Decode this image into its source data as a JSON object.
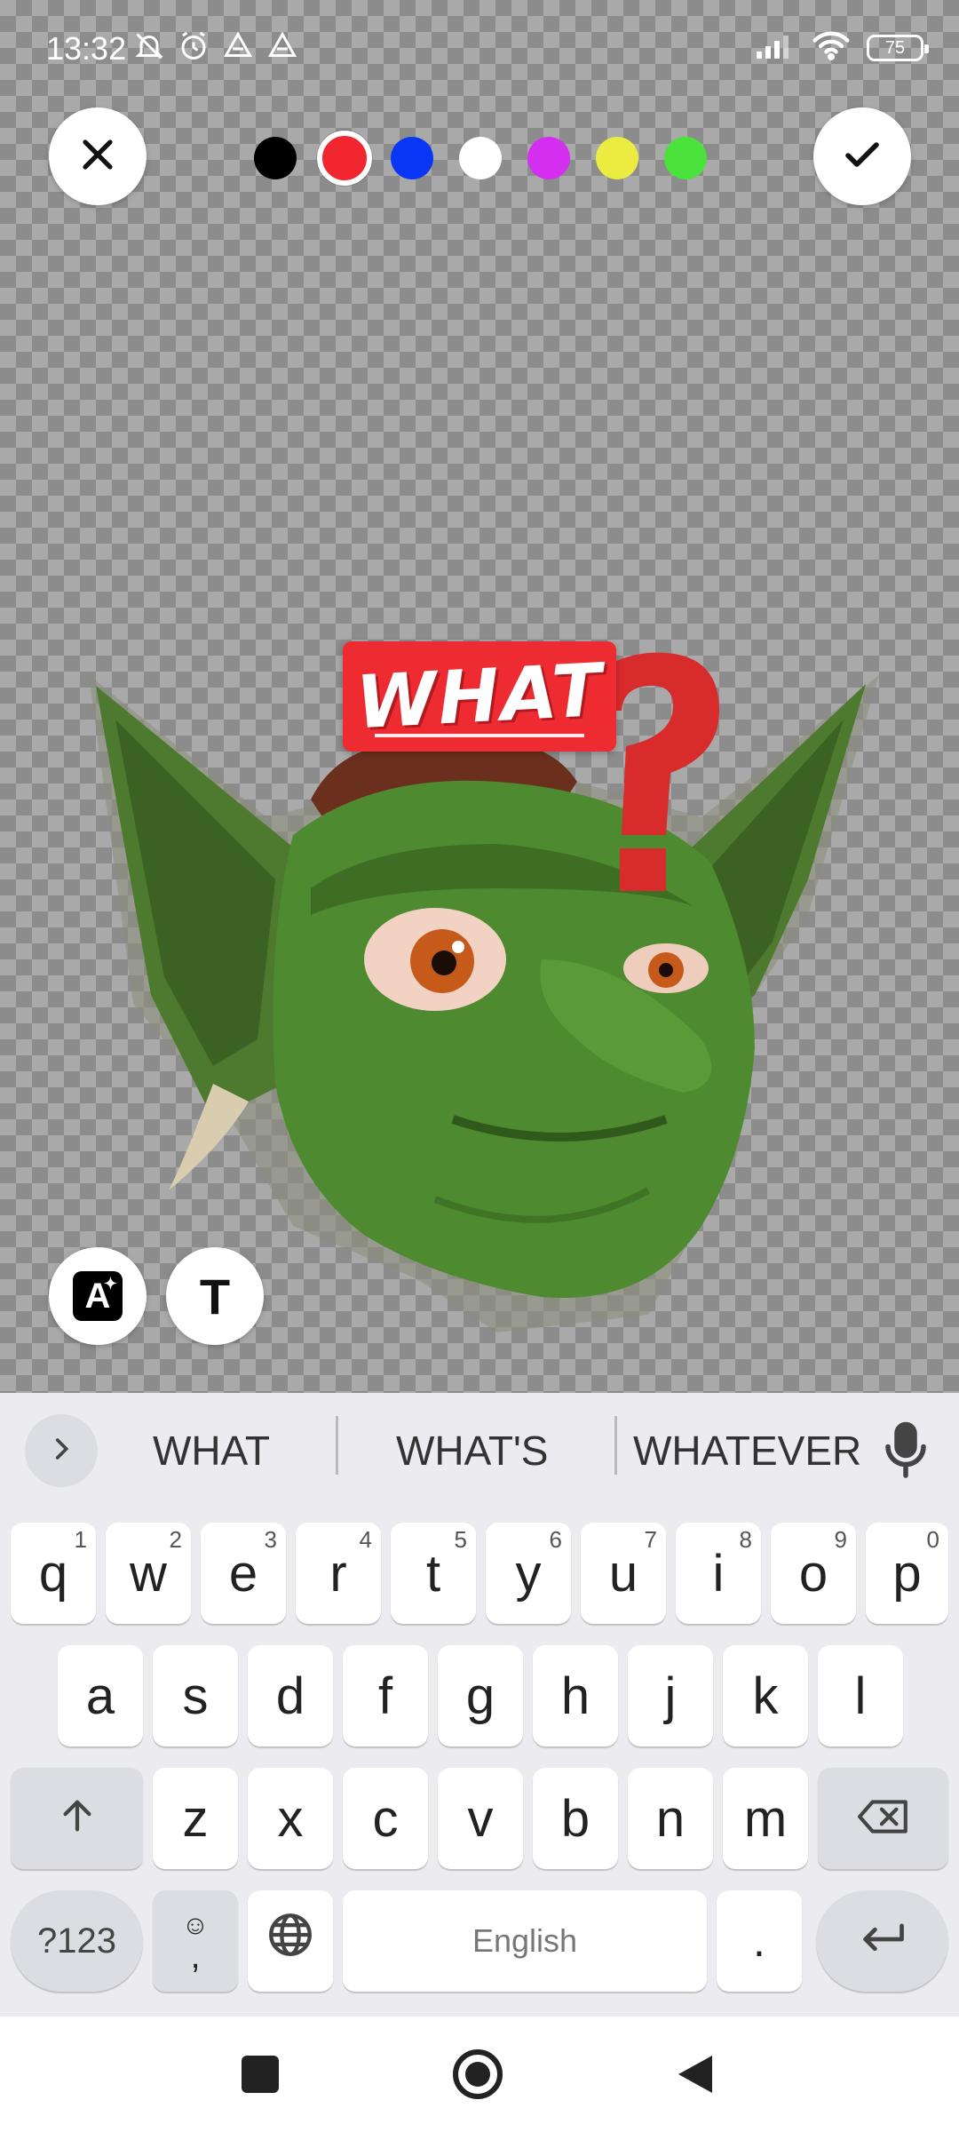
{
  "status_bar": {
    "time": "13:32",
    "battery": "75",
    "left_icons": [
      "muted-bell-icon",
      "alarm-icon",
      "drive-icon",
      "drive-icon"
    ],
    "right_icons": [
      "signal-icon",
      "wifi-icon",
      "battery-icon"
    ]
  },
  "toolbar": {
    "close_icon": "close-icon",
    "confirm_icon": "check-icon",
    "colors": [
      {
        "name": "black",
        "hex": "#000000",
        "selected": false
      },
      {
        "name": "red",
        "hex": "#f2262e",
        "selected": true
      },
      {
        "name": "blue",
        "hex": "#0a37f5",
        "selected": false
      },
      {
        "name": "white",
        "hex": "#ffffff",
        "selected": false
      },
      {
        "name": "purple",
        "hex": "#d42ef0",
        "selected": false
      },
      {
        "name": "yellow",
        "hex": "#ecec40",
        "selected": false
      },
      {
        "name": "green",
        "hex": "#4be23c",
        "selected": false
      }
    ]
  },
  "sticker": {
    "caption": "WHAT",
    "caption_bg": "#ef2b32"
  },
  "tools": {
    "ai_text": "A",
    "text_tool": "T"
  },
  "keyboard": {
    "suggestions": [
      "WHAT",
      "WHAT'S",
      "WHATEVER"
    ],
    "row1": [
      [
        "q",
        "1"
      ],
      [
        "w",
        "2"
      ],
      [
        "e",
        "3"
      ],
      [
        "r",
        "4"
      ],
      [
        "t",
        "5"
      ],
      [
        "y",
        "6"
      ],
      [
        "u",
        "7"
      ],
      [
        "i",
        "8"
      ],
      [
        "o",
        "9"
      ],
      [
        "p",
        "0"
      ]
    ],
    "row2": [
      "a",
      "s",
      "d",
      "f",
      "g",
      "h",
      "j",
      "k",
      "l"
    ],
    "row3": [
      "z",
      "x",
      "c",
      "v",
      "b",
      "n",
      "m"
    ],
    "symbols_key": "?123",
    "comma_key": ",",
    "space_label": "English",
    "period_key": "."
  }
}
